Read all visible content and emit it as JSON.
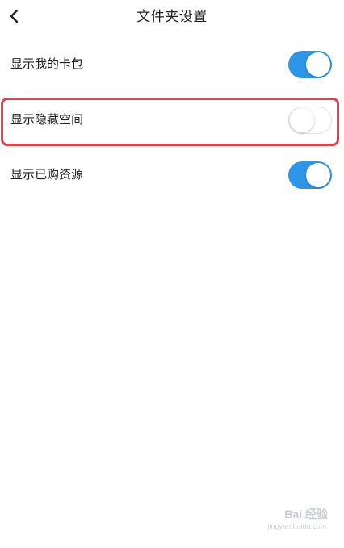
{
  "header": {
    "title": "文件夹设置",
    "back_icon": "chevron-left-icon"
  },
  "settings": [
    {
      "label": "显示我的卡包",
      "enabled": true
    },
    {
      "label": "显示隐藏空间",
      "enabled": false
    },
    {
      "label": "显示已购资源",
      "enabled": true
    }
  ],
  "colors": {
    "toggle_on": "#2f95e6",
    "toggle_off_border": "#e3e3e3",
    "highlight_border": "#e2424b"
  },
  "watermark": {
    "text": "Bai 经验",
    "subtext": "jingyan.baidu.com"
  }
}
